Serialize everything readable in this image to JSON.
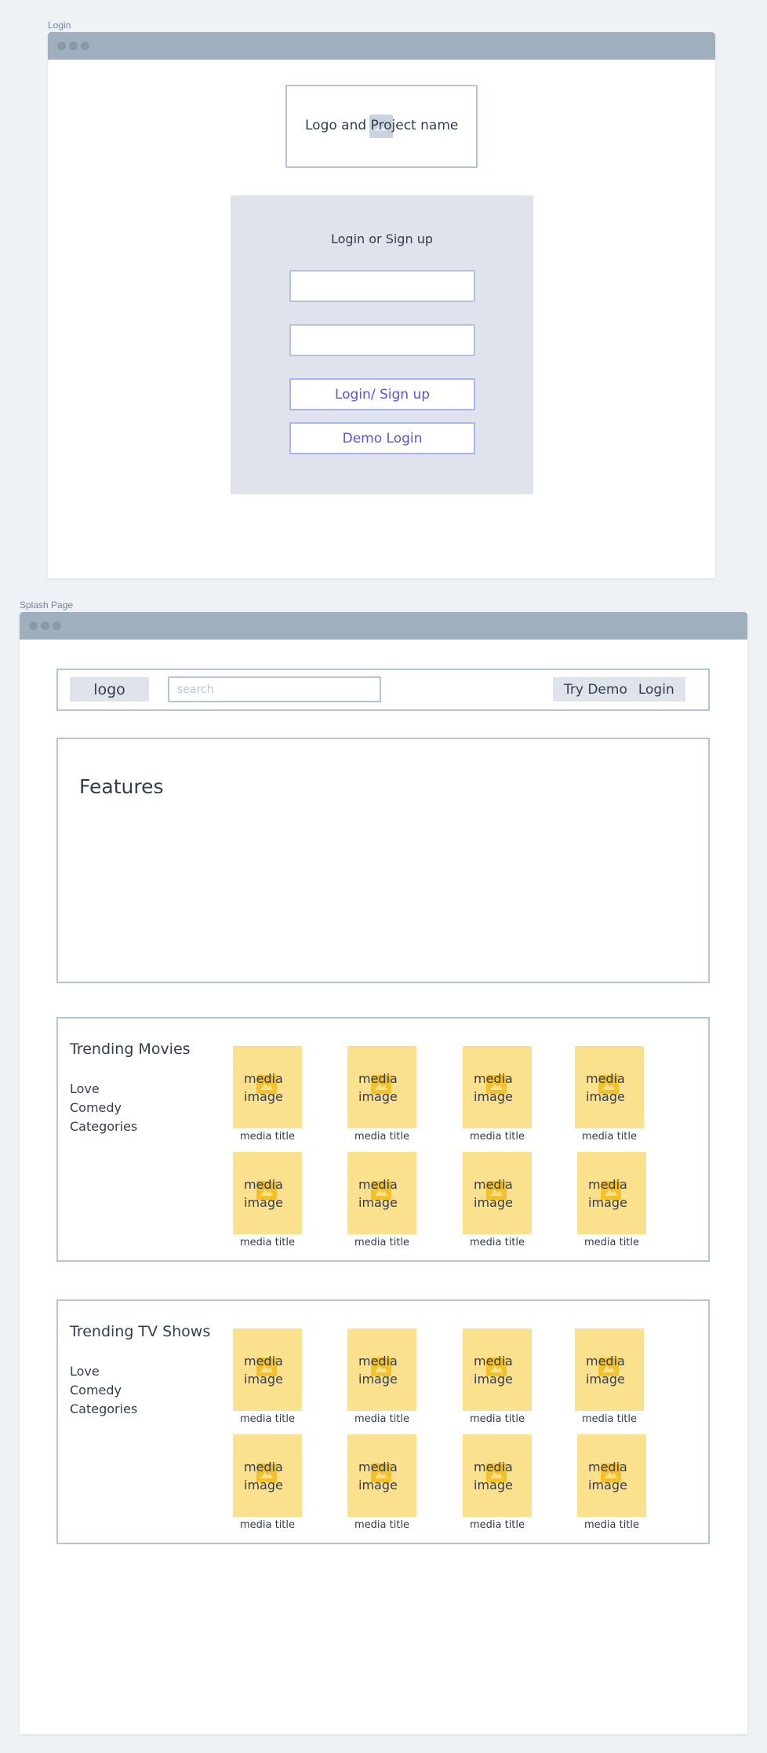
{
  "frames": {
    "login_label": "Login",
    "splash_label": "Splash Page"
  },
  "login": {
    "logo_text": "Logo and Project name",
    "auth_title": "Login or Sign up",
    "input_1_value": "",
    "input_2_value": "",
    "login_signup_button": "Login/ Sign up",
    "demo_login_button": "Demo Login"
  },
  "splash": {
    "nav": {
      "logo": "logo",
      "search_placeholder": "search",
      "try_demo": "Try Demo",
      "login": "Login"
    },
    "features_title": "Features",
    "movies": {
      "title": "Trending Movies",
      "categories": [
        "Love",
        "Comedy",
        "Categories"
      ],
      "items": [
        {
          "image": "media image",
          "title": "media title"
        },
        {
          "image": "media image",
          "title": "media title"
        },
        {
          "image": "media image",
          "title": "media title"
        },
        {
          "image": "media image",
          "title": "media title"
        },
        {
          "image": "media image",
          "title": "media title"
        },
        {
          "image": "media image",
          "title": "media title"
        },
        {
          "image": "media image",
          "title": "media title"
        },
        {
          "image": "media image",
          "title": "media title"
        }
      ]
    },
    "tv": {
      "title": "Trending TV Shows",
      "categories": [
        "Love",
        "Comedy",
        "Categories"
      ],
      "items": [
        {
          "image": "media image",
          "title": "media title"
        },
        {
          "image": "media image",
          "title": "media title"
        },
        {
          "image": "media image",
          "title": "media title"
        },
        {
          "image": "media image",
          "title": "media title"
        },
        {
          "image": "media image",
          "title": "media title"
        },
        {
          "image": "media image",
          "title": "media title"
        },
        {
          "image": "media image",
          "title": "media title"
        },
        {
          "image": "media image",
          "title": "media title"
        }
      ]
    }
  },
  "colors": {
    "background": "#eef2f6",
    "titlebar": "#a0afbd",
    "panel": "#dfe4ec",
    "border": "#b4c4d8",
    "accent_text": "#5a52e0",
    "media_placeholder": "#fbe08e",
    "media_icon": "#f4c12a"
  }
}
